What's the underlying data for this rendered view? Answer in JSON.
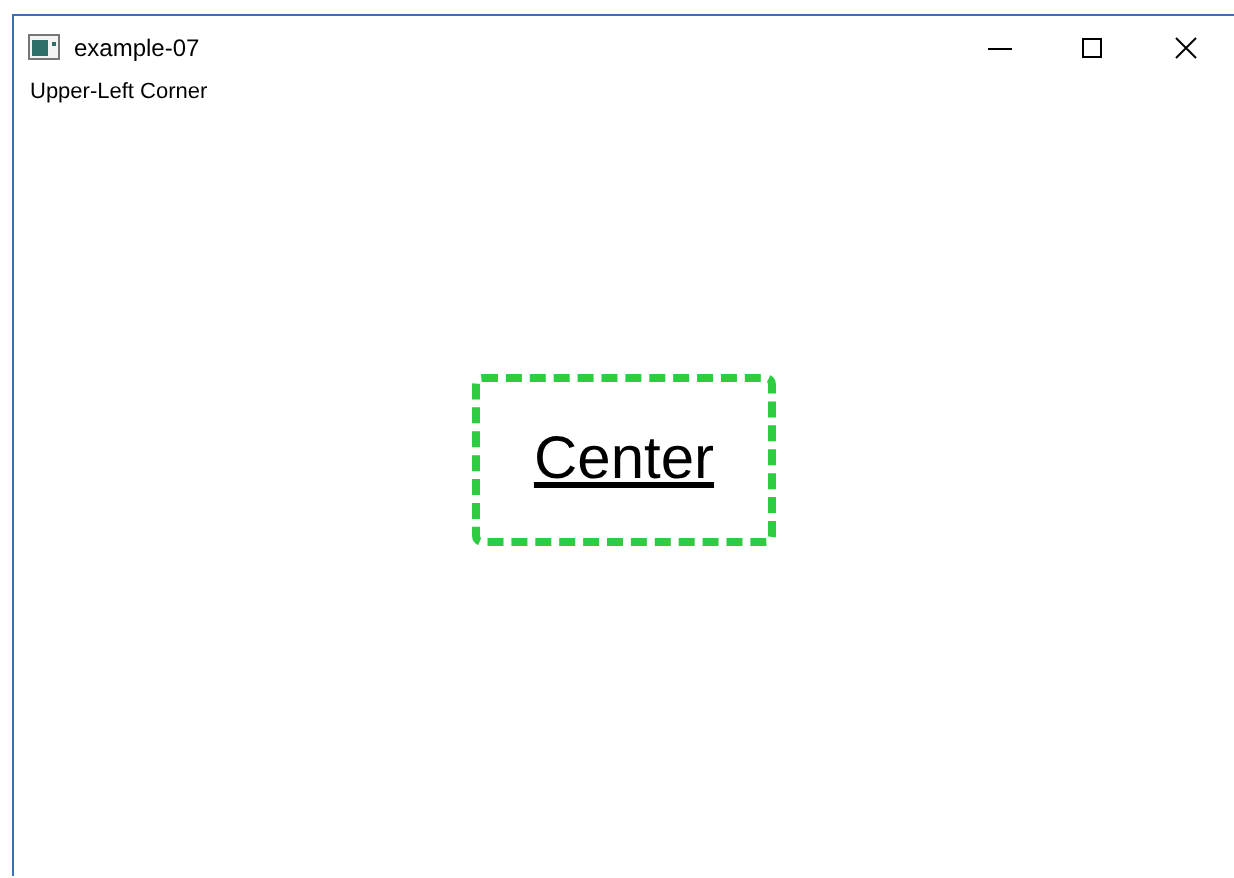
{
  "window": {
    "title": "example-07"
  },
  "corner_label": "Upper-Left Corner",
  "center_box": {
    "text": "Center"
  }
}
